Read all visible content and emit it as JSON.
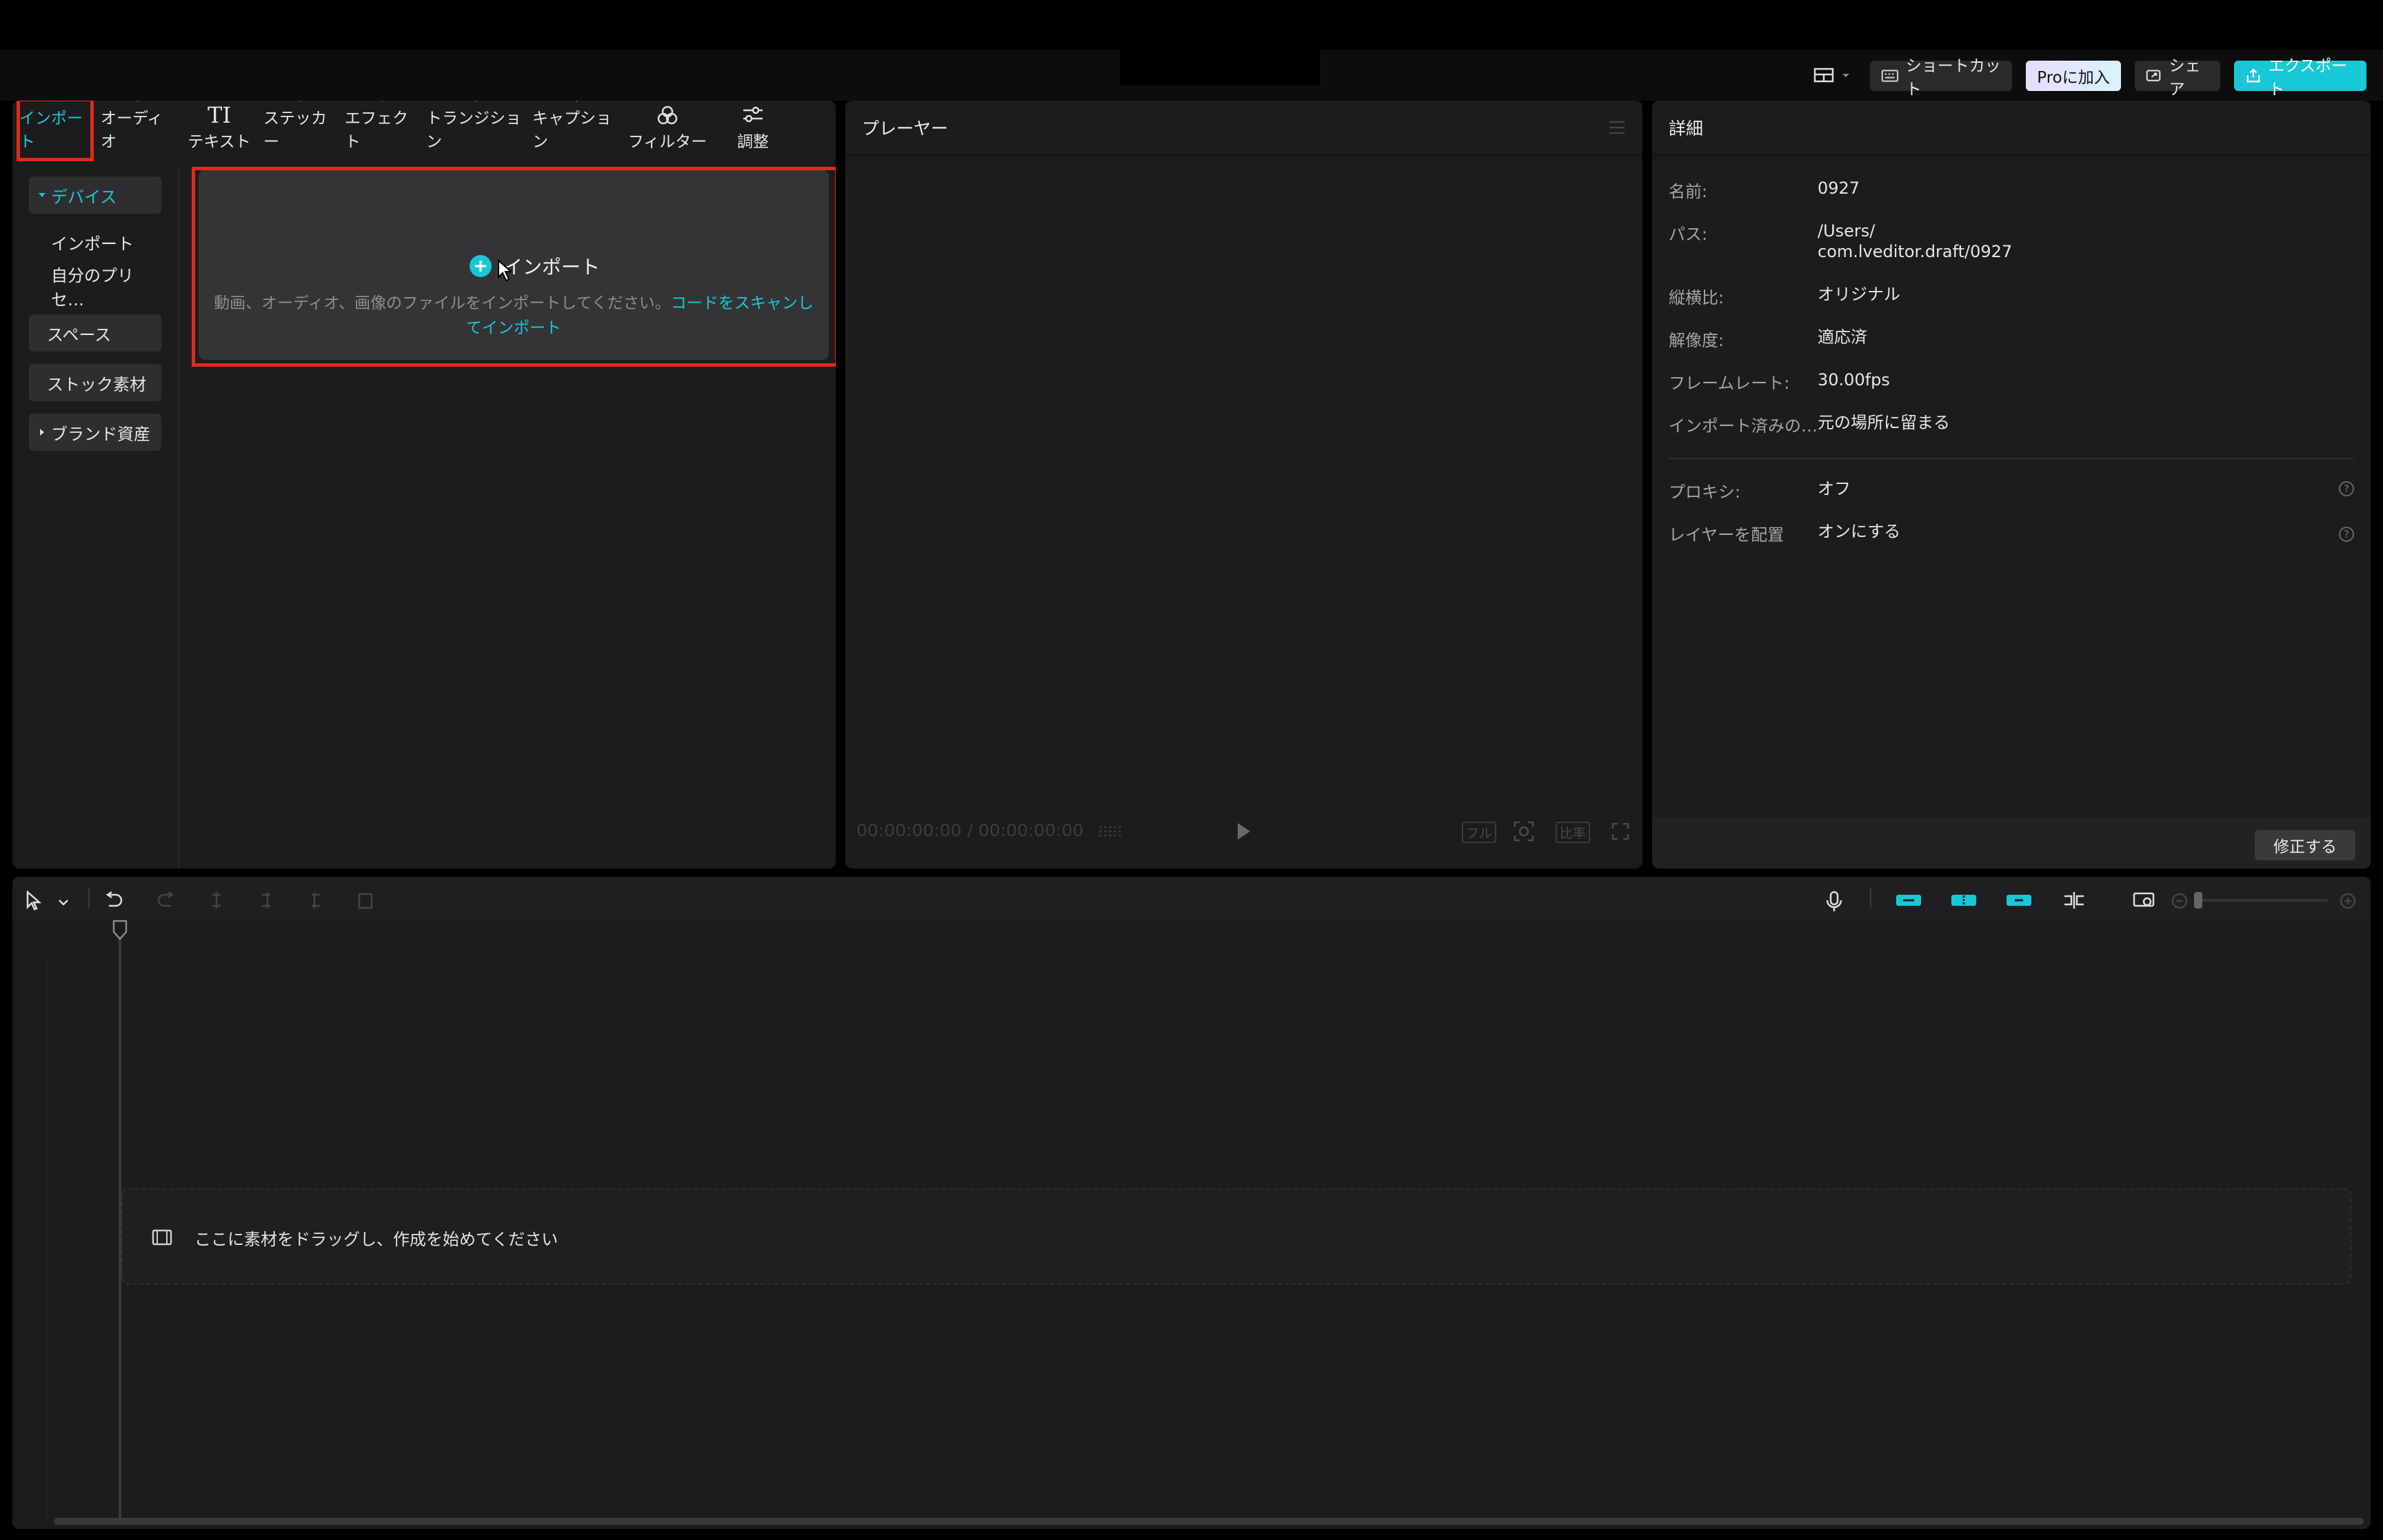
{
  "topbar": {
    "shortcut_label": "ショートカット",
    "pro_label": "Proに加入",
    "share_label": "シェア",
    "export_label": "エクスポート"
  },
  "tabs": [
    {
      "label": "インポート",
      "icon": "import-icon"
    },
    {
      "label": "オーディオ",
      "icon": "audio-icon"
    },
    {
      "label": "テキスト",
      "icon": "text-icon"
    },
    {
      "label": "ステッカー",
      "icon": "sticker-icon"
    },
    {
      "label": "エフェクト",
      "icon": "effect-icon"
    },
    {
      "label": "トランジション",
      "icon": "transition-icon"
    },
    {
      "label": "キャプション",
      "icon": "caption-icon"
    },
    {
      "label": "フィルター",
      "icon": "filter-icon"
    },
    {
      "label": "調整",
      "icon": "adjust-icon"
    }
  ],
  "tab_text_icon_glyph": "TI",
  "sidenav": {
    "device": "デバイス",
    "import": "インポート",
    "presets": "自分のプリセ…",
    "space": "スペース",
    "stock": "ストック素材",
    "brand": "ブランド資産"
  },
  "dropzone": {
    "import_label": "インポート",
    "hint": "動画、オーディオ、画像のファイルをインポートしてください。",
    "link": "コードをスキャンしてインポート"
  },
  "player": {
    "title": "プレーヤー",
    "timecode": "00:00:00:00 / 00:00:00:00",
    "full_label": "フル",
    "ratio_label": "比率"
  },
  "details": {
    "title": "詳細",
    "rows": [
      {
        "label": "名前:",
        "value": "0927"
      },
      {
        "label": "パス:",
        "value": "/Users/",
        "value2": "com.lveditor.draft/0927"
      },
      {
        "label": "縦横比:",
        "value": "オリジナル"
      },
      {
        "label": "解像度:",
        "value": "適応済"
      },
      {
        "label": "フレームレート:",
        "value": "30.00fps"
      },
      {
        "label": "インポート済みの…",
        "value": "元の場所に留まる"
      },
      {
        "label": "プロキシ:",
        "value": "オフ"
      },
      {
        "label": "レイヤーを配置",
        "value": "オンにする"
      }
    ],
    "modify_label": "修正する"
  },
  "timeline": {
    "drop_hint": "ここに素材をドラッグし、作成を始めてください"
  },
  "colors": {
    "accent": "#19c8d6",
    "highlight": "#e02a1a",
    "panel": "#1c1c1e"
  }
}
